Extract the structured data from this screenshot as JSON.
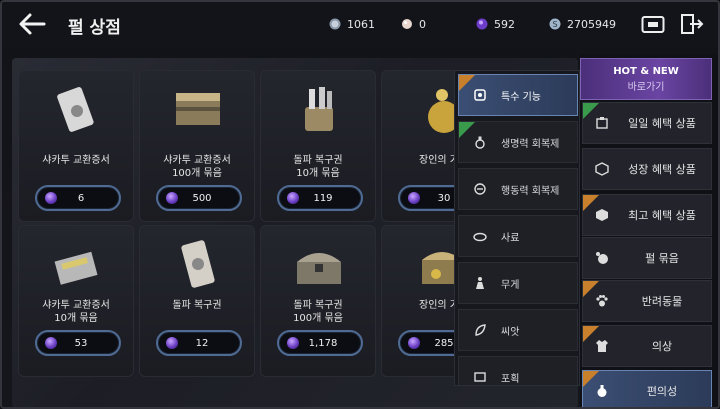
{
  "header": {
    "title": "펄 상점",
    "currencies": [
      {
        "icon": "silver-coin-icon",
        "value": "1061"
      },
      {
        "icon": "pearl-icon",
        "value": "0"
      },
      {
        "icon": "purple-gem-icon",
        "value": "592"
      },
      {
        "icon": "silver-s-icon",
        "value": "2705949"
      }
    ]
  },
  "shop": {
    "items": [
      {
        "name": "샤카투 교환증서",
        "qty": "",
        "price": "6"
      },
      {
        "name": "샤카투 교환증서",
        "qty": "100개 묶음",
        "price": "500"
      },
      {
        "name": "돌파 복구권",
        "qty": "10개 묶음",
        "price": "119"
      },
      {
        "name": "장인의 가",
        "qty": "",
        "price": "30"
      },
      {
        "name": "샤카투 교환증서",
        "qty": "10개 묶음",
        "price": "53"
      },
      {
        "name": "돌파 복구권",
        "qty": "",
        "price": "12"
      },
      {
        "name": "돌파 복구권",
        "qty": "100개 묶음",
        "price": "1,178"
      },
      {
        "name": "장인의 가",
        "qty": "",
        "price": "285"
      }
    ]
  },
  "dropdown": {
    "items": [
      {
        "label": "특수 기능",
        "icon": "special-function-icon",
        "selected": true
      },
      {
        "label": "생명력 회복제",
        "icon": "potion-icon",
        "selected": false
      },
      {
        "label": "행동력 회복제",
        "icon": "stamina-icon",
        "selected": false
      },
      {
        "label": "사료",
        "icon": "feed-icon",
        "selected": false
      },
      {
        "label": "무게",
        "icon": "weight-icon",
        "selected": false
      },
      {
        "label": "씨앗",
        "icon": "seed-icon",
        "selected": false
      },
      {
        "label": "포획",
        "icon": "capture-icon",
        "selected": false
      }
    ]
  },
  "sidebar": {
    "hot": {
      "title": "HOT & NEW",
      "subtitle": "바로가기"
    },
    "items": [
      {
        "label": "일일 혜택 상품",
        "icon": "daily-box-icon"
      },
      {
        "label": "성장 혜택 상품",
        "icon": "growth-box-icon"
      },
      {
        "label": "최고 혜택 상품",
        "icon": "best-box-icon"
      },
      {
        "label": "펄 묶음",
        "icon": "pearl-bundle-icon"
      },
      {
        "label": "반려동물",
        "icon": "paw-icon"
      },
      {
        "label": "의상",
        "icon": "outfit-icon"
      },
      {
        "label": "편의성",
        "icon": "convenience-icon"
      }
    ]
  },
  "colors": {
    "accent": "#4f6b93",
    "hot": "#6a45a3",
    "tag_orange": "#c8802c",
    "tag_green": "#3a9a4c"
  }
}
